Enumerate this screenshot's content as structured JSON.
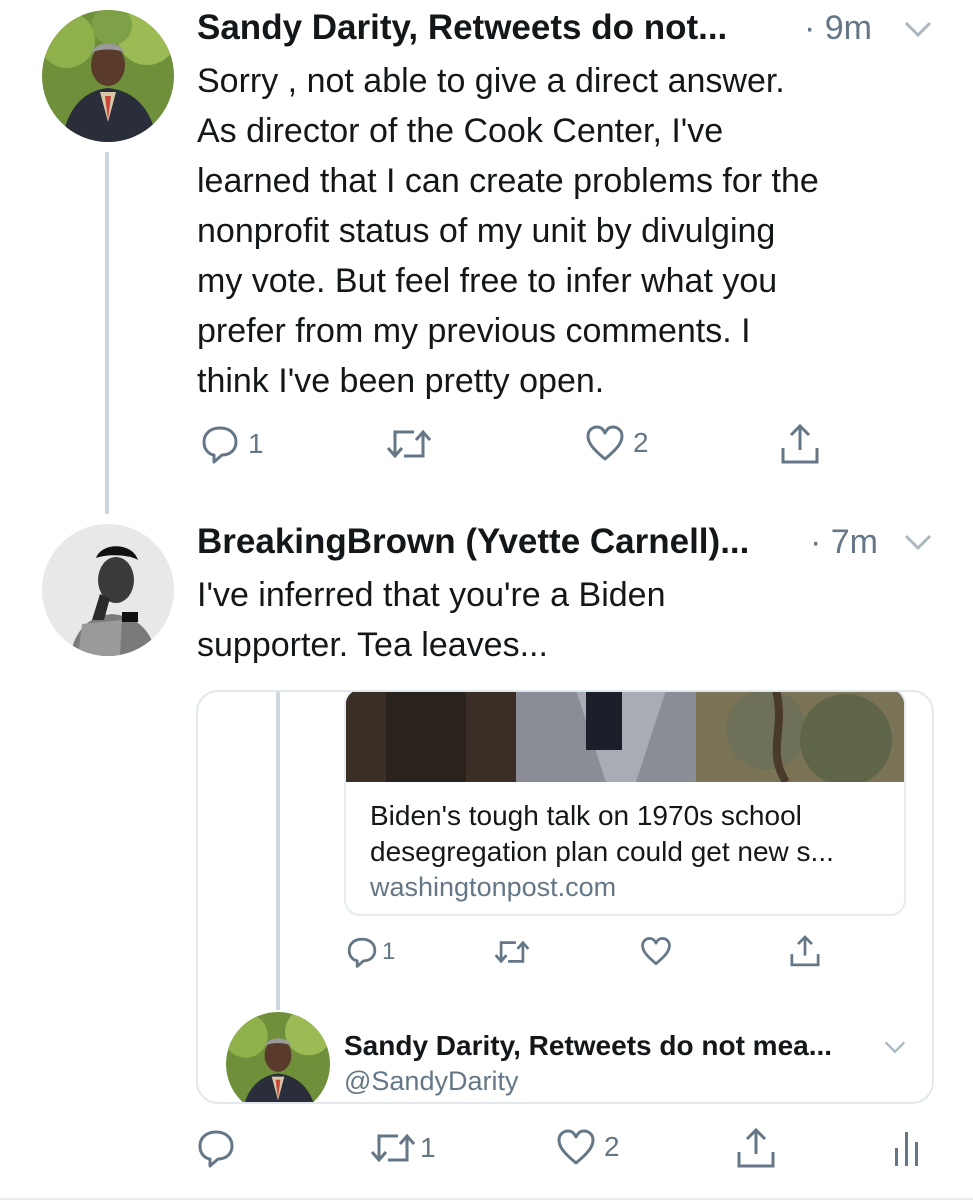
{
  "tweet1": {
    "name": "Sandy Darity, Retweets do not...",
    "time": "· 9m",
    "text_lines": [
      "Sorry , not able to give a direct answer.",
      "As director of the Cook Center,  I've",
      "learned that I can create problems for the",
      "nonprofit status of my unit by divulging",
      "my vote. But feel free to infer what you",
      "prefer from my previous comments. I",
      "think I've been pretty open."
    ],
    "replies": "1",
    "likes": "2"
  },
  "tweet2": {
    "name": "BreakingBrown (Yvette Carnell)...",
    "time": "· 7m",
    "text_lines": [
      "I've inferred that you're a Biden",
      "supporter. Tea leaves..."
    ],
    "retweets": "1",
    "likes": "2"
  },
  "quoted": {
    "link_title_lines": [
      "Biden's tough talk on 1970s school",
      "desegregation plan could get new s..."
    ],
    "link_domain": "washingtonpost.com",
    "replies": "1",
    "next_name": "Sandy Darity, Retweets do not mea...",
    "next_handle": "@SandyDarity"
  },
  "icons": {
    "reply": "reply-icon",
    "retweet": "retweet-icon",
    "like": "heart-icon",
    "share": "share-icon",
    "caret": "chevron-down-icon",
    "analytics": "analytics-icon"
  },
  "colors": {
    "text": "#14171a",
    "secondary": "#657786",
    "thread_line": "#ccd6dd",
    "border": "#e1e8ed"
  }
}
